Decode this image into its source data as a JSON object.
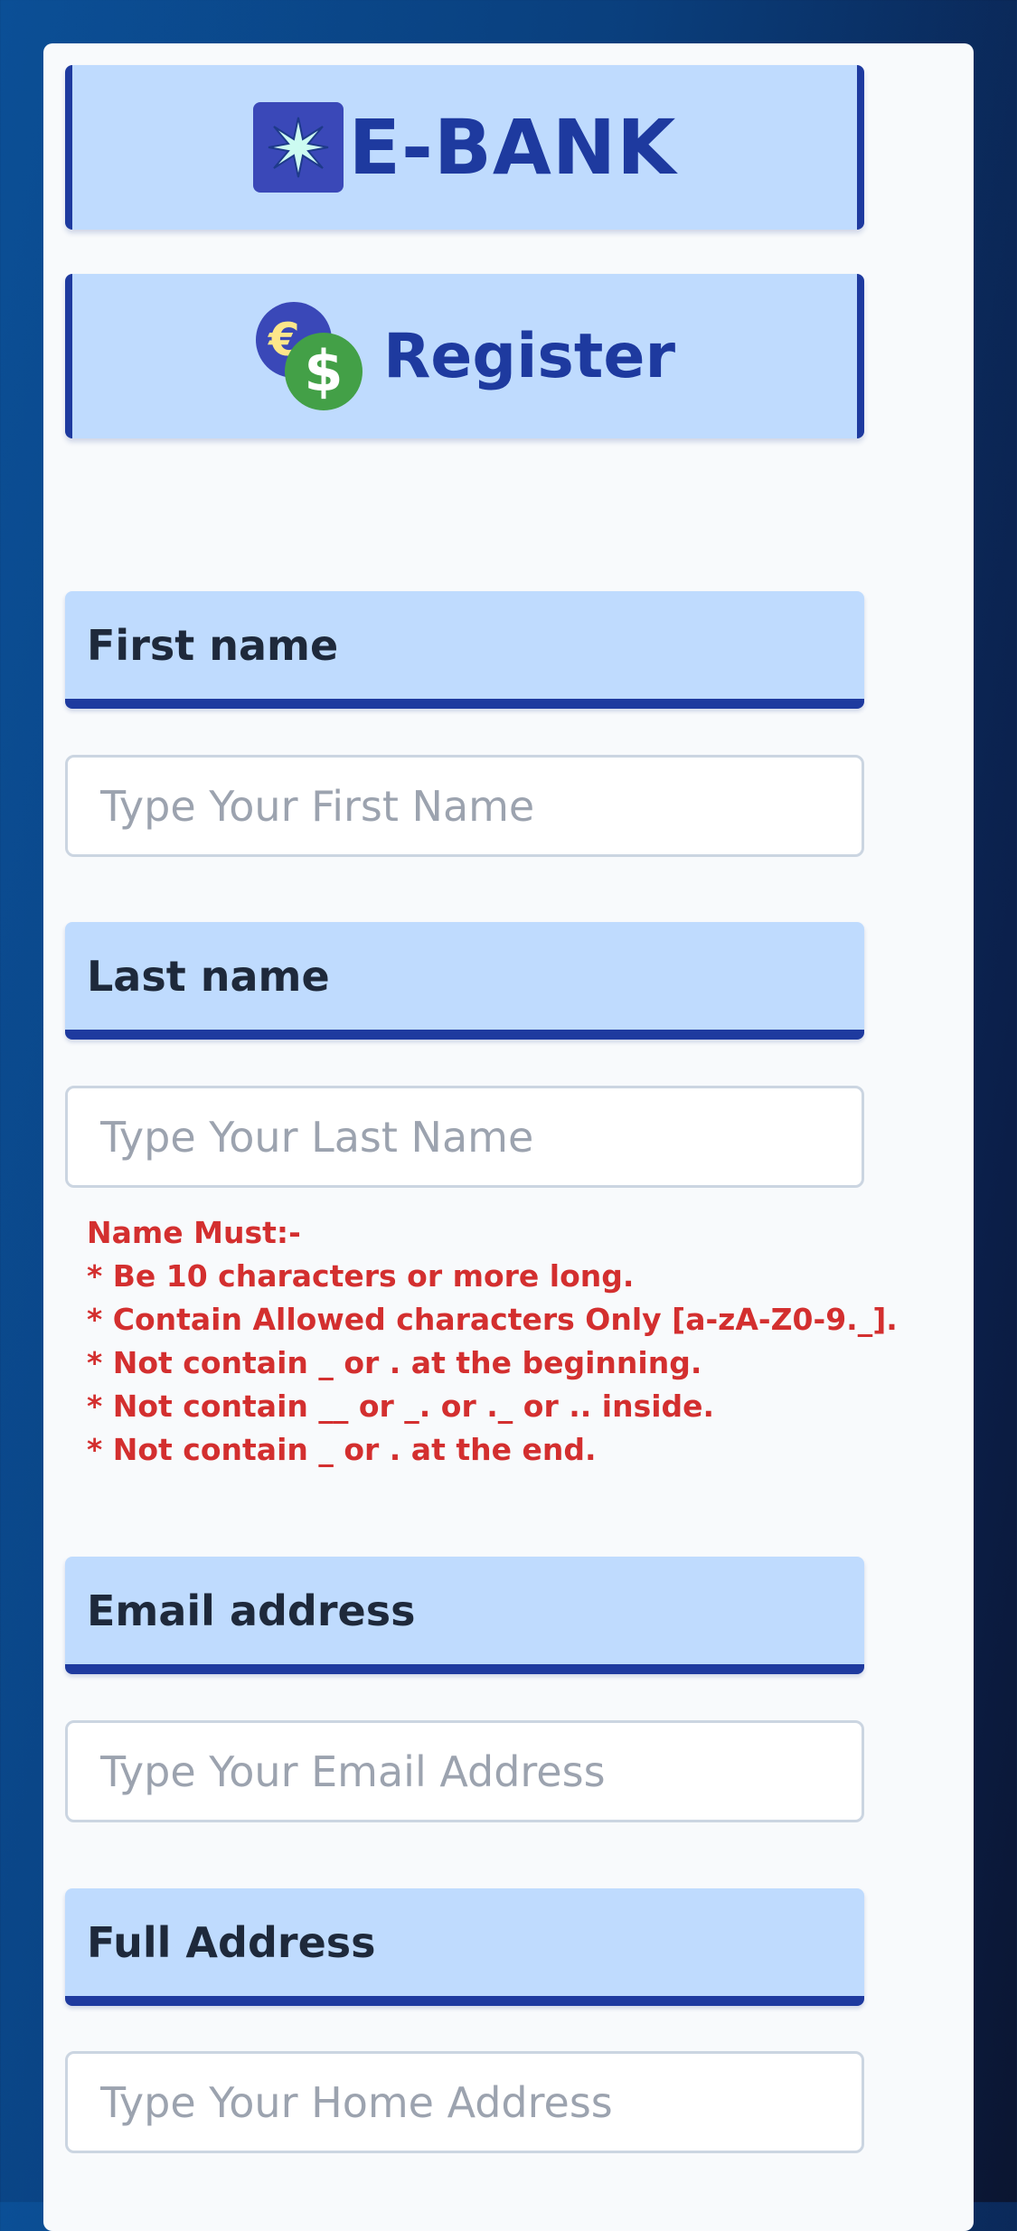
{
  "brand": {
    "title": "E-BANK",
    "logo_icon": "starburst-logo-icon"
  },
  "register": {
    "title": "Register",
    "icon": "currency-coins-icon",
    "euro_symbol": "€",
    "dollar_symbol": "$"
  },
  "fields": {
    "first_name": {
      "label": "First name",
      "placeholder": "Type Your First Name"
    },
    "last_name": {
      "label": "Last name",
      "placeholder": "Type Your Last Name"
    },
    "email": {
      "label": "Email address",
      "placeholder": "Type Your Email Address"
    },
    "address": {
      "label": "Full Address",
      "placeholder": "Type Your Home Address"
    }
  },
  "name_rules": {
    "heading": "Name Must:-",
    "items": [
      "* Be 10 characters or more long.",
      "* Contain Allowed characters Only [a-zA-Z0-9._].",
      "* Not contain _ or . at the beginning.",
      "* Not contain __ or _. or ._ or .. inside.",
      "* Not contain _ or . at the end."
    ]
  },
  "colors": {
    "accent": "#1e3a9f",
    "label_bg": "#bfdbfe",
    "error_text": "#d32f2f",
    "card_bg": "#f8fafc"
  }
}
